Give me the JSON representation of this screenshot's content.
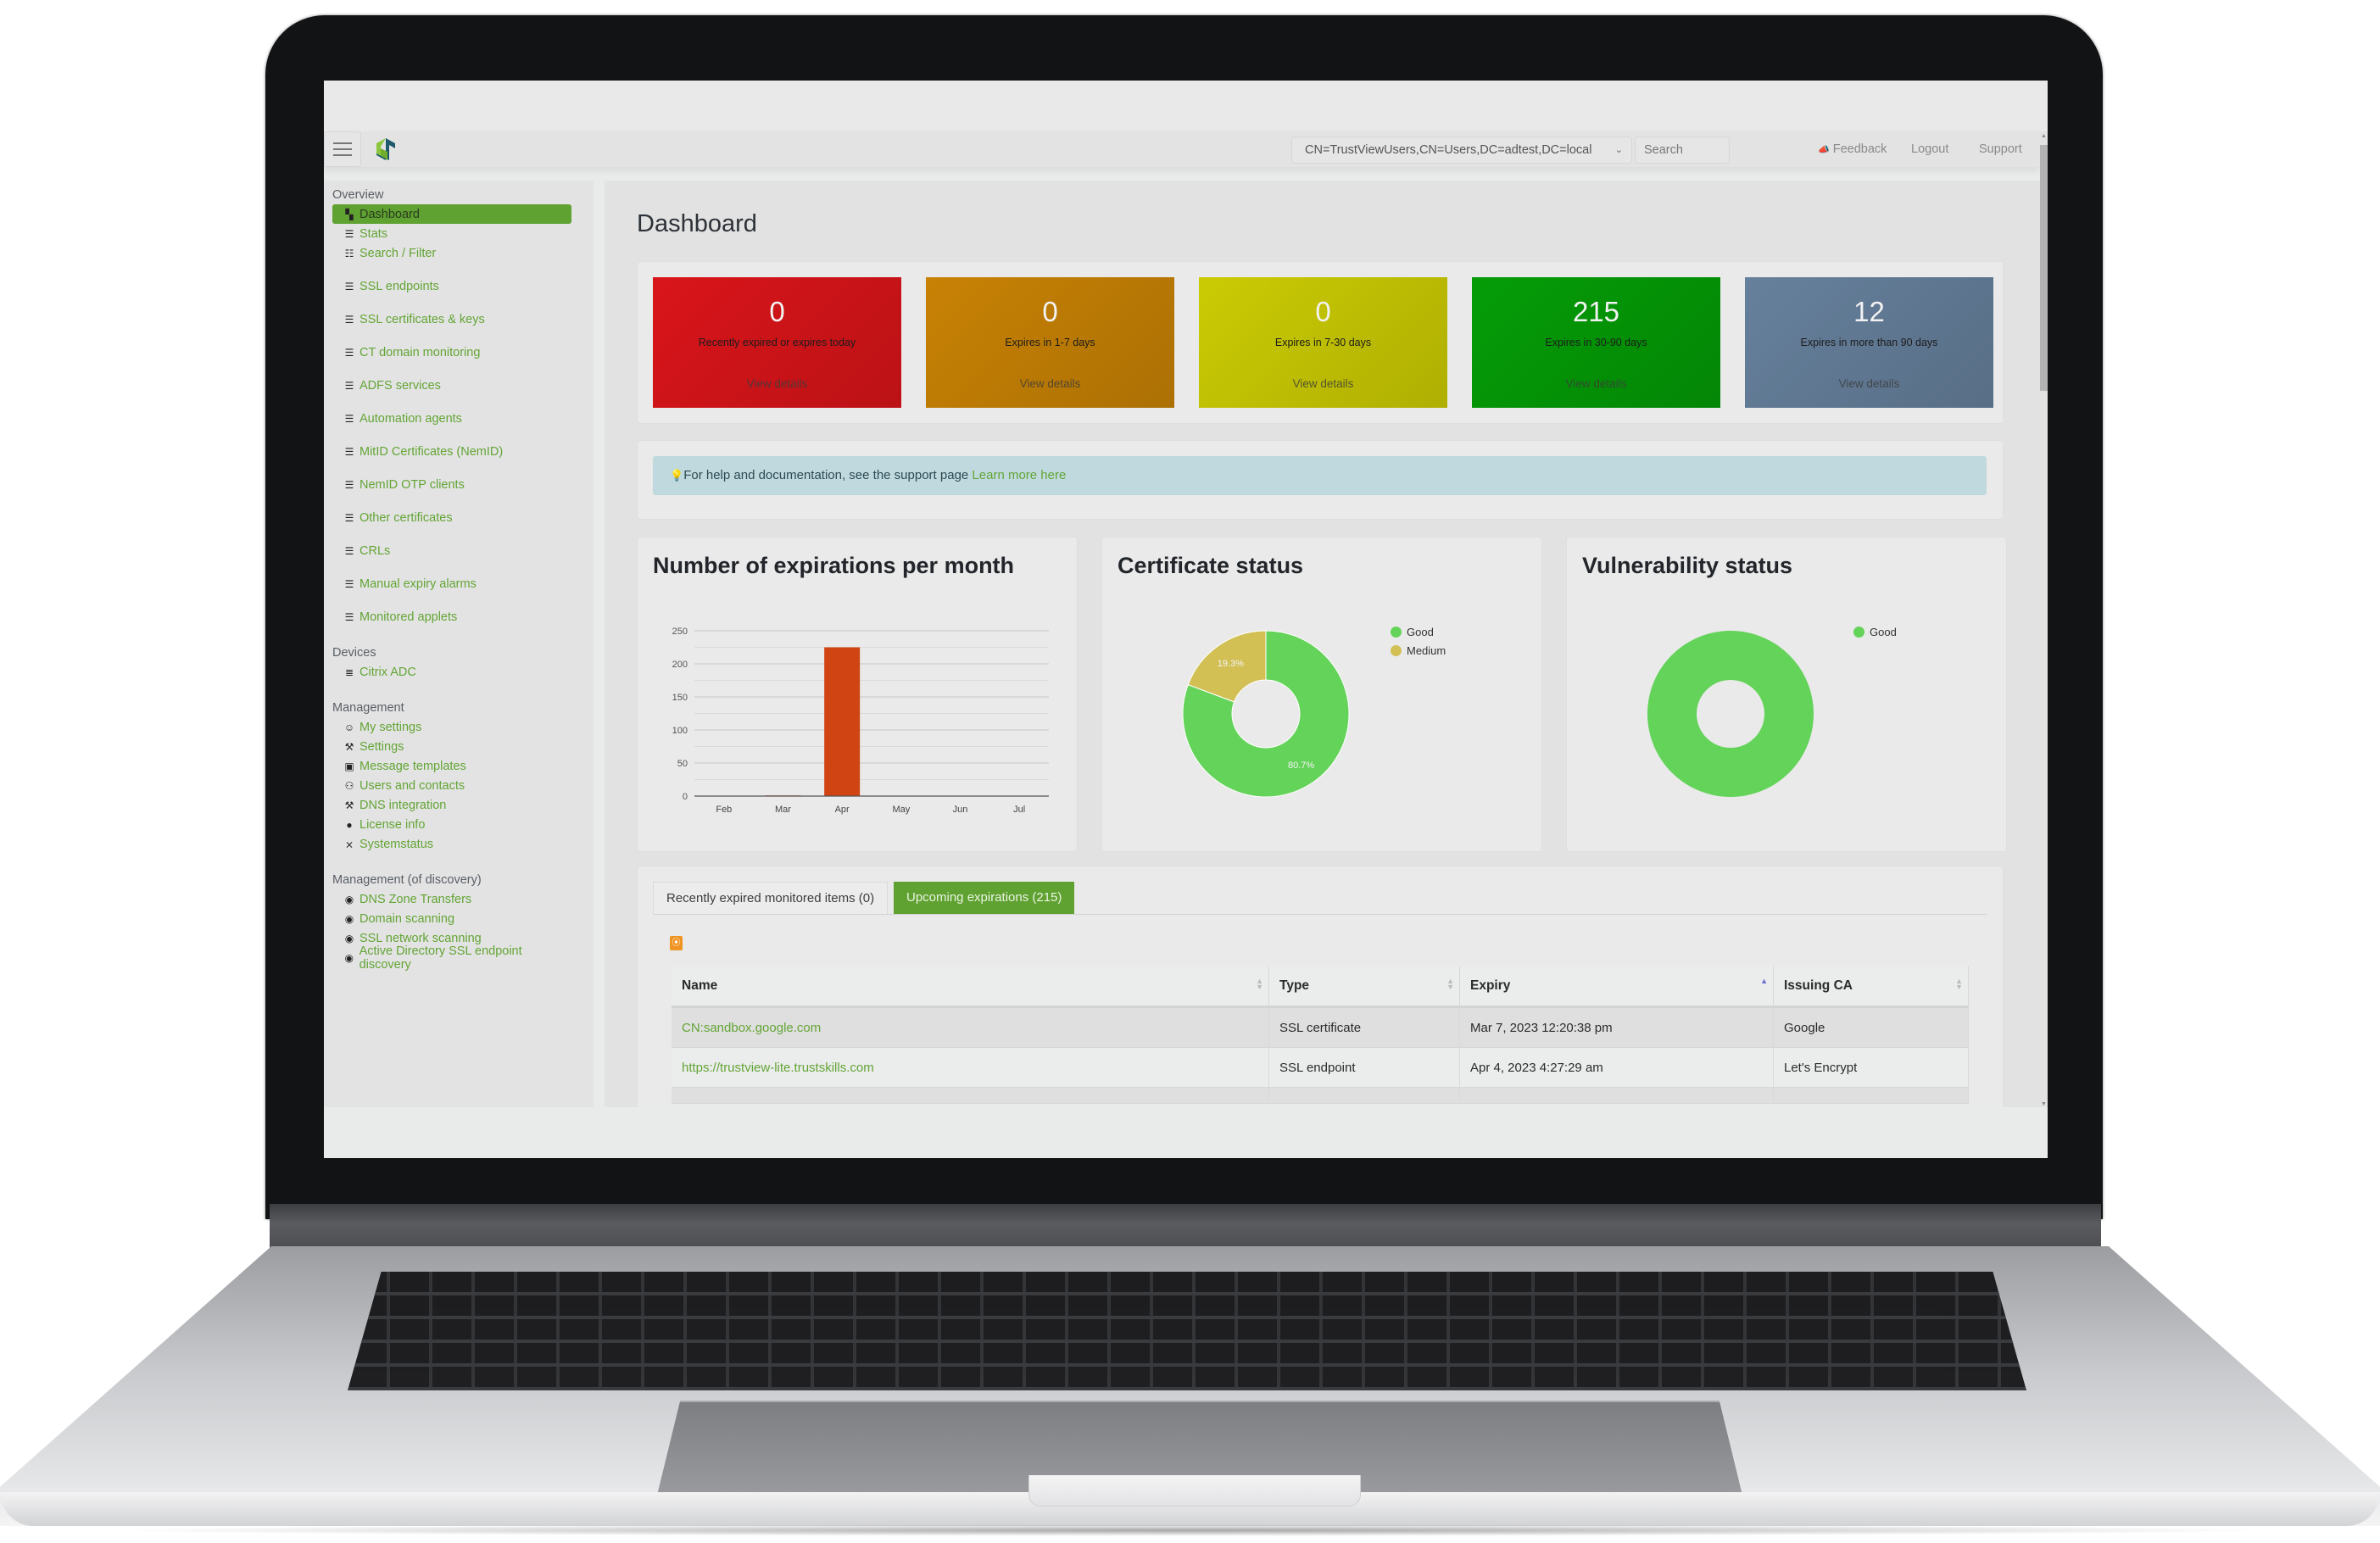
{
  "navbar": {
    "menu_icon": "hamburger-icon",
    "logo_icon": "app-logo",
    "dn_select_value": "CN=TrustViewUsers,CN=Users,DC=adtest,DC=local",
    "search_placeholder": "Search",
    "feedback_label": "Feedback",
    "feedback_icon": "megaphone-icon",
    "logout_label": "Logout",
    "support_label": "Support"
  },
  "sidebar": {
    "sections": [
      {
        "title": "Overview",
        "items": [
          {
            "label": "Dashboard",
            "icon": "dashboard-icon",
            "active": true
          },
          {
            "label": "Stats",
            "icon": "list-icon"
          },
          {
            "label": "Search / Filter",
            "icon": "search-list-icon"
          },
          {
            "label": "SSL endpoints",
            "icon": "list-icon"
          },
          {
            "label": "SSL certificates & keys",
            "icon": "list-icon"
          },
          {
            "label": "CT domain monitoring",
            "icon": "list-icon"
          },
          {
            "label": "ADFS services",
            "icon": "list-icon"
          },
          {
            "label": "Automation agents",
            "icon": "list-icon"
          },
          {
            "label": "MitID Certificates (NemID)",
            "icon": "list-icon"
          },
          {
            "label": "NemID OTP clients",
            "icon": "list-icon"
          },
          {
            "label": "Other certificates",
            "icon": "list-icon"
          },
          {
            "label": "CRLs",
            "icon": "list-icon"
          },
          {
            "label": "Manual expiry alarms",
            "icon": "list-icon"
          },
          {
            "label": "Monitored applets",
            "icon": "list-icon"
          }
        ]
      },
      {
        "title": "Devices",
        "items": [
          {
            "label": "Citrix ADC",
            "icon": "server-icon"
          }
        ]
      },
      {
        "title": "Management",
        "items": [
          {
            "label": "My settings",
            "icon": "user-gear-icon"
          },
          {
            "label": "Settings",
            "icon": "wrench-icon"
          },
          {
            "label": "Message templates",
            "icon": "message-icon"
          },
          {
            "label": "Users and contacts",
            "icon": "users-icon"
          },
          {
            "label": "DNS integration",
            "icon": "wrench-icon"
          },
          {
            "label": "License info",
            "icon": "exclamation-circle-icon"
          },
          {
            "label": "Systemstatus",
            "icon": "status-icon"
          }
        ]
      },
      {
        "title": "Management (of discovery)",
        "items": [
          {
            "label": "DNS Zone Transfers",
            "icon": "eye-icon"
          },
          {
            "label": "Domain scanning",
            "icon": "eye-icon"
          },
          {
            "label": "SSL network scanning",
            "icon": "eye-icon"
          },
          {
            "label": "Active Directory SSL endpoint discovery",
            "icon": "eye-icon"
          }
        ]
      }
    ]
  },
  "main": {
    "title": "Dashboard",
    "stats": [
      {
        "value": "0",
        "label": "Recently expired or expires today",
        "link": "View details",
        "color": "#d9151a"
      },
      {
        "value": "0",
        "label": "Expires in 1-7 days",
        "link": "View details",
        "color": "#c88205"
      },
      {
        "value": "0",
        "label": "Expires in 7-30 days",
        "link": "View details",
        "color": "#cbcb04"
      },
      {
        "value": "215",
        "label": "Expires in 30-90 days",
        "link": "View details",
        "color": "#059c07"
      },
      {
        "value": "12",
        "label": "Expires in more than 90 days",
        "link": "View details",
        "color": "#66809c"
      }
    ],
    "help": {
      "icon": "lightbulb-icon",
      "text": "For help and documentation, see the support page ",
      "link": "Learn more here"
    },
    "tabs": [
      {
        "label": "Recently expired monitored items (0)",
        "active": false
      },
      {
        "label": "Upcoming expirations (215)",
        "active": true
      }
    ],
    "rss_icon": "rss-icon",
    "table": {
      "columns": [
        "Name",
        "Type",
        "Expiry",
        "Issuing CA"
      ],
      "sorted_column": "Expiry",
      "sort_direction": "ascending",
      "rows": [
        {
          "name": "CN:sandbox.google.com",
          "type": "SSL certificate",
          "expiry": "Mar 7, 2023 12:20:38 pm",
          "ca": "Google"
        },
        {
          "name": "https://trustview-lite.trustskills.com",
          "type": "SSL endpoint",
          "expiry": "Apr 4, 2023 4:27:29 am",
          "ca": "Let's Encrypt"
        }
      ]
    }
  },
  "chart_data": [
    {
      "type": "bar",
      "title": "Number of expirations per month",
      "categories": [
        "Feb",
        "Mar",
        "Apr",
        "May",
        "Jun",
        "Jul"
      ],
      "values": [
        0,
        1,
        225,
        0,
        0,
        0
      ],
      "xlabel": "",
      "ylabel": "",
      "ylim": [
        0,
        250
      ],
      "yticks": [
        0,
        50,
        100,
        150,
        200,
        250
      ],
      "grid": true,
      "color": "#d04413"
    },
    {
      "type": "pie",
      "title": "Certificate status",
      "donut": true,
      "labels": [
        "Good",
        "Medium"
      ],
      "values": [
        80.7,
        19.3
      ],
      "value_labels": [
        "80.7%",
        "19.3%"
      ],
      "colors": [
        "#64d35a",
        "#d2c055"
      ],
      "legend": "right"
    },
    {
      "type": "pie",
      "title": "Vulnerability status",
      "donut": true,
      "labels": [
        "Good"
      ],
      "values": [
        100
      ],
      "value_labels": [],
      "colors": [
        "#64d35a"
      ],
      "legend": "right"
    }
  ]
}
